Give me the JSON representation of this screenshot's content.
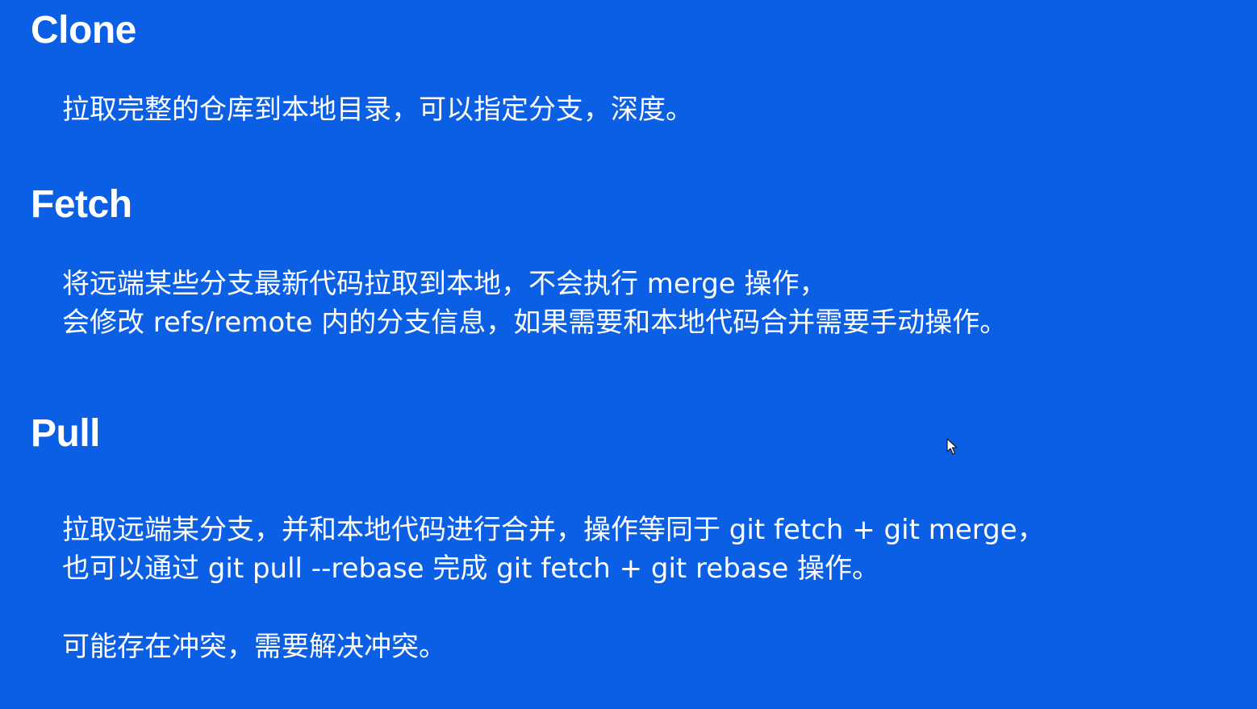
{
  "sections": {
    "clone": {
      "title": "Clone",
      "lines": [
        "拉取完整的仓库到本地目录，可以指定分支，深度。"
      ]
    },
    "fetch": {
      "title": "Fetch",
      "lines": [
        "将远端某些分支最新代码拉取到本地，不会执行 merge 操作，",
        "会修改 refs/remote 内的分支信息，如果需要和本地代码合并需要手动操作。"
      ]
    },
    "pull": {
      "title": "Pull",
      "lines": [
        "拉取远端某分支，并和本地代码进行合并，操作等同于 git fetch + git merge，",
        "也可以通过 git pull --rebase 完成 git fetch + git rebase 操作。"
      ],
      "note": "可能存在冲突，需要解决冲突。"
    }
  },
  "colors": {
    "background": "#0a5fe4",
    "text": "#ffffff"
  },
  "icons": {
    "cursor": "mouse-pointer-icon"
  }
}
